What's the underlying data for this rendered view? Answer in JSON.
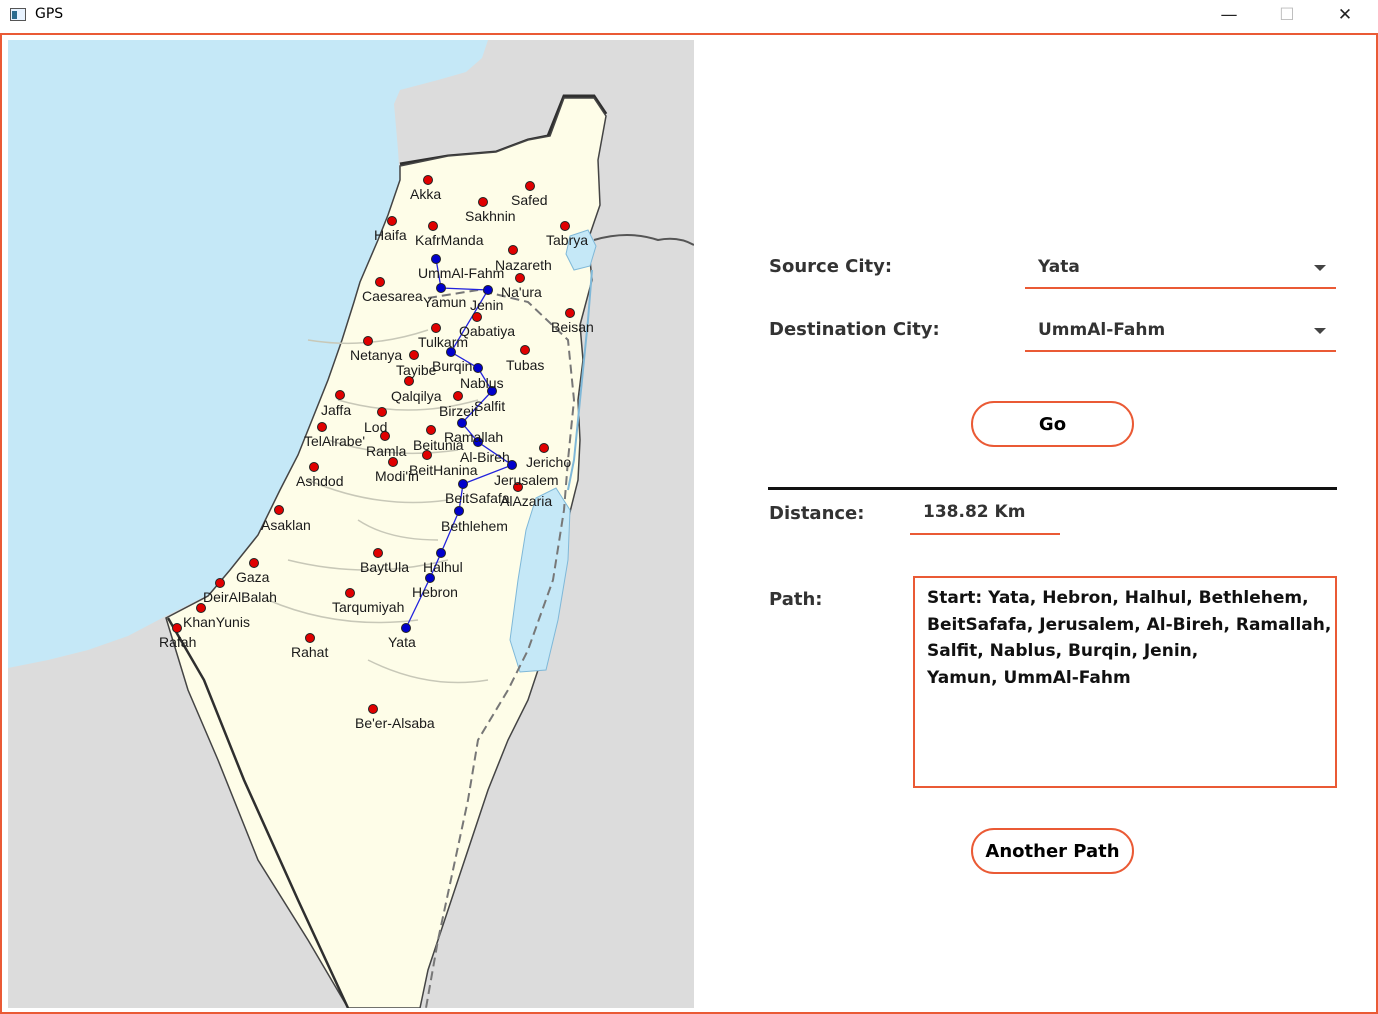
{
  "window": {
    "title": "GPS",
    "minimize_symbol": "—",
    "maximize_symbol": "☐",
    "close_symbol": "✕"
  },
  "form": {
    "source_label": "Source City:",
    "source_value": "Yata",
    "destination_label": "Destination City:",
    "destination_value": "UmmAl-Fahm",
    "go_label": "Go",
    "distance_label": "Distance:",
    "distance_value": "138.82 Km",
    "path_label": "Path:",
    "path_lines": [
      "Start: Yata, Hebron, Halhul, Bethlehem,",
      "BeitSafafa, Jerusalem, Al-Bireh, Ramallah,",
      "Salfit, Nablus, Burqin, Jenin,",
      "Yamun, UmmAl-Fahm"
    ],
    "another_path_label": "Another Path"
  },
  "colors": {
    "accent": "#ea5a35",
    "sea": "#c5e8f7",
    "land": "#fefde8",
    "outside_land": "#dcdcdc",
    "city_marker": "#e00000",
    "path_marker": "#0000cc",
    "path_line": "#2222dd"
  },
  "map": {
    "cities": [
      {
        "name": "Akka",
        "on_path": false
      },
      {
        "name": "Safed",
        "on_path": false
      },
      {
        "name": "Sakhnin",
        "on_path": false
      },
      {
        "name": "Haifa",
        "on_path": false
      },
      {
        "name": "KafrManda",
        "on_path": false
      },
      {
        "name": "Tabrya",
        "on_path": false
      },
      {
        "name": "UmmAl-Fahm",
        "on_path": true
      },
      {
        "name": "Nazareth",
        "on_path": false
      },
      {
        "name": "Caesarea",
        "on_path": false
      },
      {
        "name": "Yamun",
        "on_path": true
      },
      {
        "name": "Jenin",
        "on_path": true
      },
      {
        "name": "Na'ura",
        "on_path": false
      },
      {
        "name": "Qabatiya",
        "on_path": false
      },
      {
        "name": "Beisan",
        "on_path": false
      },
      {
        "name": "Netanya",
        "on_path": false
      },
      {
        "name": "Tulkarm",
        "on_path": false
      },
      {
        "name": "Tayibe",
        "on_path": false
      },
      {
        "name": "Burqin",
        "on_path": true
      },
      {
        "name": "Tubas",
        "on_path": false
      },
      {
        "name": "Nablus",
        "on_path": true
      },
      {
        "name": "Qalqilya",
        "on_path": false
      },
      {
        "name": "Jaffa",
        "on_path": false
      },
      {
        "name": "Birzeit",
        "on_path": false
      },
      {
        "name": "Salfit",
        "on_path": true
      },
      {
        "name": "Lod",
        "on_path": false
      },
      {
        "name": "TelAlrabe'",
        "on_path": false
      },
      {
        "name": "Ramallah",
        "on_path": true
      },
      {
        "name": "Beitunia",
        "on_path": false
      },
      {
        "name": "Ramla",
        "on_path": false
      },
      {
        "name": "Jericho",
        "on_path": false
      },
      {
        "name": "Al-Bireh",
        "on_path": true
      },
      {
        "name": "BeitHanina",
        "on_path": false
      },
      {
        "name": "Modi'in",
        "on_path": false
      },
      {
        "name": "Jerusalem",
        "on_path": true
      },
      {
        "name": "Ashdod",
        "on_path": false
      },
      {
        "name": "BeitSafafa",
        "on_path": true
      },
      {
        "name": "AlAzaria",
        "on_path": false
      },
      {
        "name": "Asaklan",
        "on_path": false
      },
      {
        "name": "Bethlehem",
        "on_path": true
      },
      {
        "name": "BaytUla",
        "on_path": false
      },
      {
        "name": "Halhul",
        "on_path": true
      },
      {
        "name": "Gaza",
        "on_path": false
      },
      {
        "name": "DeirAlBalah",
        "on_path": false
      },
      {
        "name": "Hebron",
        "on_path": true
      },
      {
        "name": "Tarqumiyah",
        "on_path": false
      },
      {
        "name": "KhanYunis",
        "on_path": false
      },
      {
        "name": "Rafah",
        "on_path": false
      },
      {
        "name": "Rahat",
        "on_path": false
      },
      {
        "name": "Yata",
        "on_path": true
      },
      {
        "name": "Be'er-Alsaba",
        "on_path": false
      }
    ]
  }
}
